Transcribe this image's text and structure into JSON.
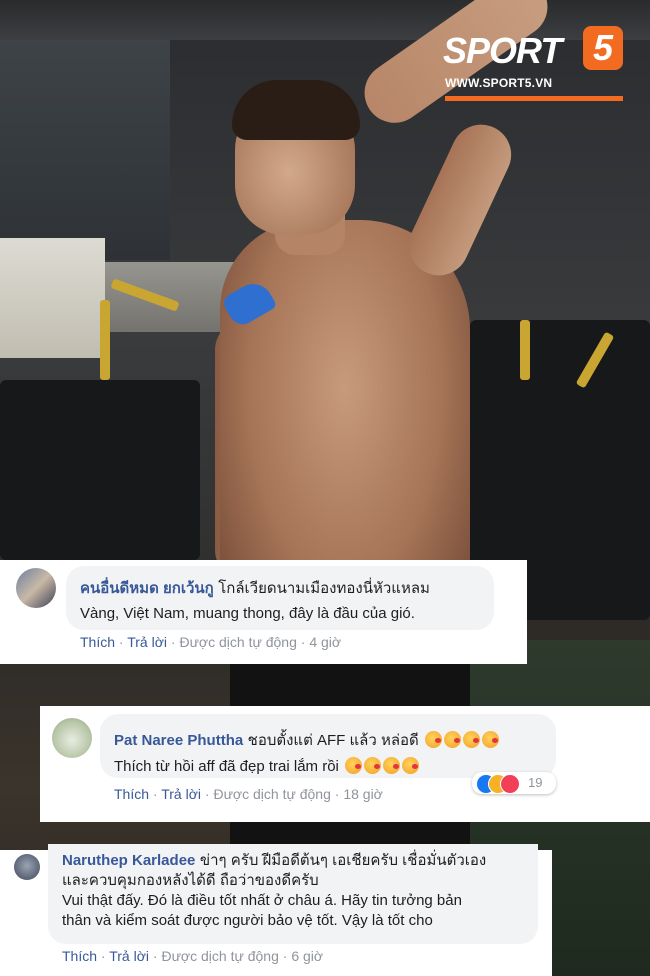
{
  "logo": {
    "brand": "SPORT",
    "number": "5",
    "url": "WWW.SPORT5.VN",
    "accent_color": "#f26b21"
  },
  "comments": [
    {
      "author": "คนอื่นดีหมด ยกเว้นกู",
      "text_line1": "โกล์เวียดนามเมืองทองนี่หัวแหลม",
      "text_line2": "Vàng, Việt Nam, muang thong, đây là đầu của gió.",
      "like": "Thích",
      "reply": "Trả lời",
      "translated": "Được dịch tự động",
      "time": "4 giờ"
    },
    {
      "author": "Pat Naree Phuttha",
      "text_line1": "ชอบตั้งแต่ AFF แล้ว หล่อดี",
      "text_line2": "Thích từ hồi aff đã đẹp trai lắm rồi",
      "like": "Thích",
      "reply": "Trả lời",
      "translated": "Được dịch tự động",
      "time": "18 giờ",
      "reaction_count": "19",
      "emoji": "kissing-heart-emoji"
    },
    {
      "author": "Naruthep Karladee",
      "text_line1": "ข่าๆ ครับ ฝีมือดีต้นๆ เอเชียครับ เชื่อมั่นตัวเอง",
      "text_line1b": "และควบคุมกองหลังได้ดี ถือว่าของดีครับ",
      "text_line2": "Vui thật đấy. Đó là điều tốt nhất ở châu á. Hãy tin tưởng bản",
      "text_line2b": "thân và kiểm soát được người bảo vệ tốt. Vậy là tốt cho",
      "like": "Thích",
      "reply": "Trả lời",
      "translated": "Được dịch tự động",
      "time": "6 giờ"
    }
  ],
  "colors": {
    "link": "#385898",
    "meta": "#90949c",
    "bubble": "#f2f3f5"
  }
}
